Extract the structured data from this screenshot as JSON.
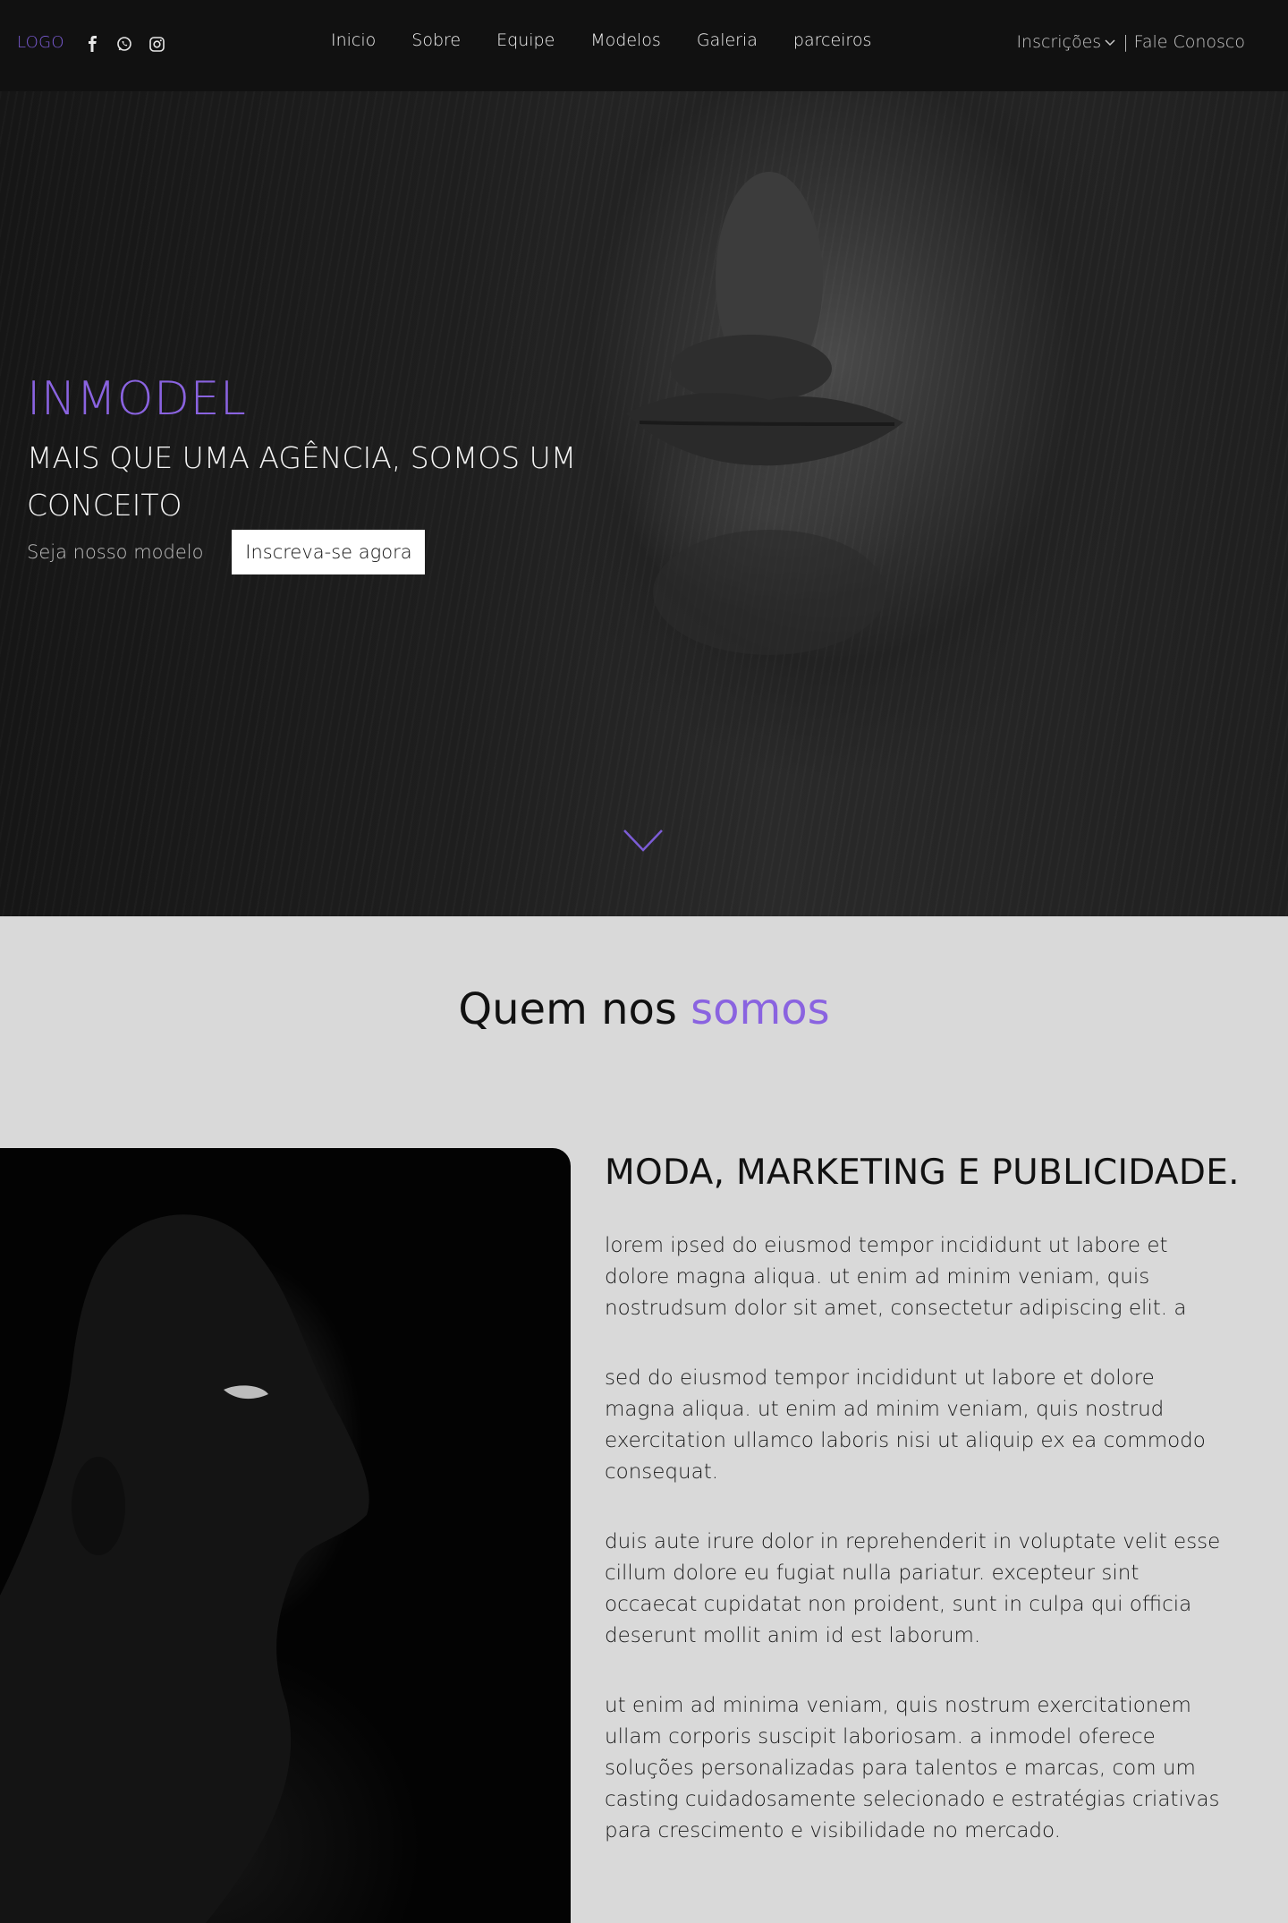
{
  "header": {
    "logo": "LOGO",
    "socials": [
      {
        "icon": "facebook-icon"
      },
      {
        "icon": "whatsapp-icon"
      },
      {
        "icon": "instagram-icon"
      }
    ],
    "nav": [
      "Inicio",
      "Sobre",
      "Equipe",
      "Modelos",
      "Galeria",
      "parceiros"
    ],
    "inscricoes": "Inscrições",
    "contact": "| Fale Conosco"
  },
  "hero": {
    "title": "INMODEL",
    "subtitle": "MAIS QUE UMA AGÊNCIA, SOMOS UM CONCEITO",
    "cta_text": "Seja nosso modelo",
    "cta_button": "Inscreva-se agora"
  },
  "about": {
    "heading_plain": "Quem nos ",
    "heading_accent": "somos",
    "title": "MODA, MARKETING E PUBLICIDADE.",
    "paragraphs": [
      "lorem ipsed do eiusmod tempor incididunt ut labore et dolore magna aliqua. ut enim ad minim veniam, quis nostrudsum dolor sit amet, consectetur adipiscing elit. a",
      "sed do eiusmod tempor incididunt ut labore et dolore magna aliqua. ut enim ad minim veniam, quis nostrud exercitation ullamco laboris nisi ut aliquip ex ea commodo consequat.",
      "duis aute irure dolor in reprehenderit in voluptate velit esse cillum dolore eu fugiat nulla pariatur. excepteur sint occaecat cupidatat non proident, sunt in culpa qui officia deserunt mollit anim id est laborum.",
      "ut enim ad minima veniam, quis nostrum exercitationem ullam corporis suscipit laboriosam. a inmodel oferece soluções personalizadas para talentos e marcas, com um casting cuidadosamente selecionado e estratégias criativas para crescimento e visibilidade no mercado."
    ]
  },
  "colors": {
    "accent": "#8a63e0",
    "navbar_bg": "#111111",
    "section_bg": "#d9d9d9"
  }
}
